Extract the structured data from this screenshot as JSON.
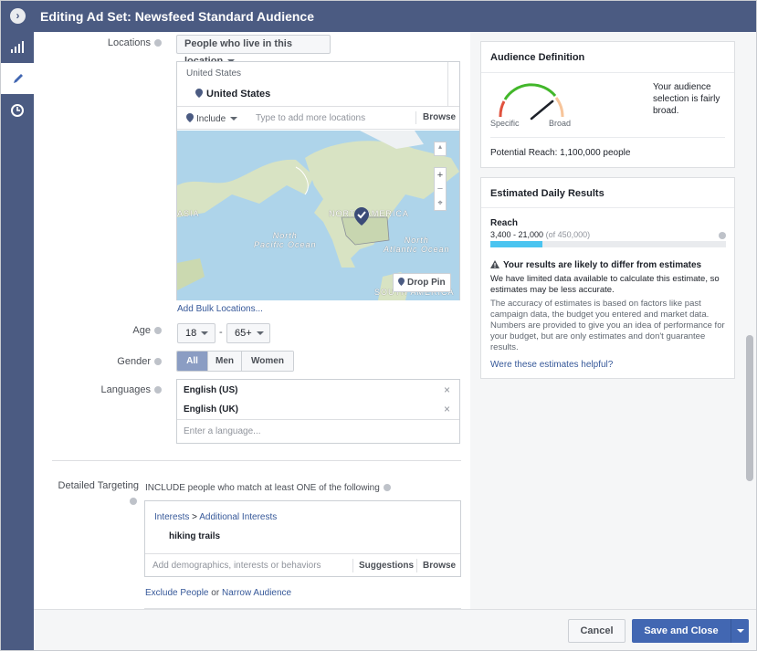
{
  "header": {
    "title": "Editing Ad Set: Newsfeed Standard Audience"
  },
  "locations": {
    "label": "Locations",
    "mode_select": "People who live in this location",
    "country_header": "United States",
    "selected": "United States",
    "include_select": "Include",
    "input_placeholder": "Type to add more locations",
    "browse": "Browse",
    "map_labels": {
      "asia": "ASIA",
      "north_pacific": "North\nPacific Ocean",
      "north_america": "NORTH AMERICA",
      "north_atlantic": "North\nAtlantic Ocean",
      "south_america": "SOUTH AMERICA"
    },
    "drop_pin": "Drop Pin",
    "bulk_link": "Add Bulk Locations..."
  },
  "age": {
    "label": "Age",
    "min": "18",
    "max": "65+",
    "separator": "-"
  },
  "gender": {
    "label": "Gender",
    "options": [
      "All",
      "Men",
      "Women"
    ],
    "selected": "All"
  },
  "languages": {
    "label": "Languages",
    "items": [
      "English (US)",
      "English (UK)"
    ],
    "placeholder": "Enter a language..."
  },
  "detailed_targeting": {
    "label": "Detailed Targeting",
    "include_text": "INCLUDE people who match at least ONE of the following",
    "path_1": "Interests",
    "path_sep": ">",
    "path_2": "Additional Interests",
    "interest": "hiking trails",
    "input_placeholder": "Add demographics, interests or behaviors",
    "suggestions": "Suggestions",
    "browse": "Browse",
    "exclude_link": "Exclude People",
    "or_text": "or",
    "narrow_link": "Narrow Audience"
  },
  "audience_definition": {
    "title": "Audience Definition",
    "specific": "Specific",
    "broad": "Broad",
    "description": "Your audience selection is fairly broad.",
    "potential_reach": "Potential Reach: 1,100,000 people",
    "gauge_level": 0.78
  },
  "daily_results": {
    "title": "Estimated Daily Results",
    "reach_label": "Reach",
    "reach_range": "3,400 - 21,000",
    "reach_total": "(of 450,000)",
    "reach_fill_fraction": 0.22,
    "warning_title": "Your results are likely to differ from estimates",
    "warning_text": "We have limited data available to calculate this estimate, so estimates may be less accurate.",
    "accuracy_text": "The accuracy of estimates is based on factors like past campaign data, the budget you entered and market data. Numbers are provided to give you an idea of performance for your budget, but are only estimates and don't guarantee results.",
    "helpful_link": "Were these estimates helpful?"
  },
  "footer": {
    "cancel": "Cancel",
    "save": "Save and Close"
  },
  "colors": {
    "header": "#4b5b82",
    "primary": "#4267b2",
    "link": "#365899",
    "reach_bar": "#4ac4f0",
    "gauge_green": "#42b72a",
    "gauge_red": "#e0523e"
  }
}
